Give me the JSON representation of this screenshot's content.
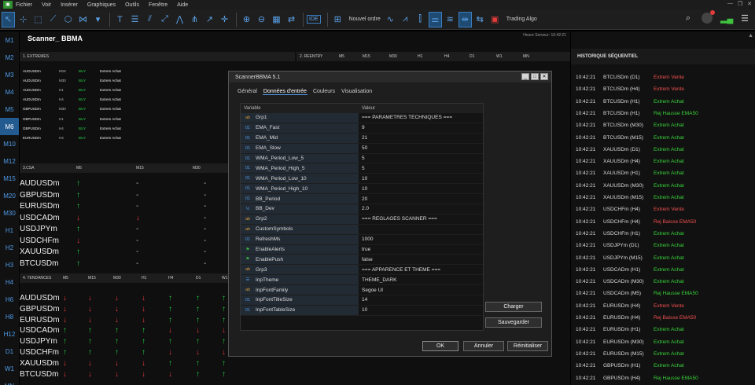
{
  "menu": {
    "items": [
      "Fichier",
      "Voir",
      "Insérer",
      "Graphiques",
      "Outils",
      "Fenêtre",
      "Aide"
    ]
  },
  "toolbar": {
    "ide": "IDE",
    "new_order": "Nouvel ordre",
    "algo": "Trading Algo"
  },
  "timeframes": [
    "M1",
    "M2",
    "M3",
    "M4",
    "M5",
    "M6",
    "M10",
    "M12",
    "M15",
    "M20",
    "M30",
    "H1",
    "H2",
    "H3",
    "H4",
    "H6",
    "H8",
    "H12",
    "D1",
    "W1",
    "MN"
  ],
  "active_timeframe": "M6",
  "panel": {
    "title": "Scanner_ BBMA",
    "info": "Heure Serveur: 10:42:21",
    "extremes": {
      "header": "1. EXTREMES",
      "rows": [
        {
          "sym": "AUDUSDm",
          "tf": "M15",
          "dir": "BUY",
          "desc": "Extrem Achat"
        },
        {
          "sym": "AUDUSDm",
          "tf": "M30",
          "dir": "BUY",
          "desc": "Extrem Achat"
        },
        {
          "sym": "AUDUSDm",
          "tf": "H1",
          "dir": "BUY",
          "desc": "Extrem Achat"
        },
        {
          "sym": "AUDUSDm",
          "tf": "H4",
          "dir": "BUY",
          "desc": "Extrem Achat"
        },
        {
          "sym": "GBPUSDm",
          "tf": "M30",
          "dir": "BUY",
          "desc": "Extrem Achat"
        },
        {
          "sym": "GBPUSDm",
          "tf": "H1",
          "dir": "BUY",
          "desc": "Extrem Achat"
        },
        {
          "sym": "GBPUSDm",
          "tf": "H4",
          "dir": "BUY",
          "desc": "Extrem Achat"
        },
        {
          "sym": "EURUSDm",
          "tf": "H4",
          "dir": "BUY",
          "desc": "Extrem Achat"
        }
      ]
    },
    "reentry": {
      "header": "2. REENTRY",
      "cols": [
        "M5",
        "M15",
        "M30",
        "H1",
        "H4",
        "D1",
        "W1",
        "MN"
      ]
    },
    "csa": {
      "header": "3.CSA",
      "cols": [
        "M5",
        "M15",
        "M30"
      ],
      "rows": [
        {
          "sym": "AUDUSDm",
          "m5": "↑",
          "m15": "-",
          "m30": "-"
        },
        {
          "sym": "GBPUSDm",
          "m5": "↑",
          "m15": "-",
          "m30": "-"
        },
        {
          "sym": "EURUSDm",
          "m5": "↑",
          "m15": "-",
          "m30": "-"
        },
        {
          "sym": "USDCADm",
          "m5": "↓",
          "m15": "↓",
          "m30": "-"
        },
        {
          "sym": "USDJPYm",
          "m5": "↑",
          "m15": "-",
          "m30": "-"
        },
        {
          "sym": "USDCHFm",
          "m5": "↓",
          "m15": "-",
          "m30": "-"
        },
        {
          "sym": "XAUUSDm",
          "m5": "↑",
          "m15": "-",
          "m30": "-"
        },
        {
          "sym": "BTCUSDm",
          "m5": "↑",
          "m15": "-",
          "m30": "-"
        }
      ]
    },
    "tendances": {
      "header": "4. TENDANCES",
      "cols": [
        "M5",
        "M15",
        "M30",
        "H1",
        "H4",
        "D1",
        "W1"
      ],
      "rows": [
        {
          "sym": "AUDUSDm",
          "v": [
            "↓",
            "↓",
            "↓",
            "↓",
            "↑",
            "↑",
            "↑"
          ]
        },
        {
          "sym": "GBPUSDm",
          "v": [
            "↓",
            "↓",
            "↓",
            "↓",
            "↑",
            "↑",
            "↑"
          ]
        },
        {
          "sym": "EURUSDm",
          "v": [
            "↓",
            "↓",
            "↓",
            "↓",
            "↑",
            "↑",
            "↑"
          ]
        },
        {
          "sym": "USDCADm",
          "v": [
            "↑",
            "↑",
            "↑",
            "↑",
            "↓",
            "↓",
            "↓"
          ]
        },
        {
          "sym": "USDJPYm",
          "v": [
            "↑",
            "↑",
            "↑",
            "↑",
            "↑",
            "↑",
            "↑"
          ]
        },
        {
          "sym": "USDCHFm",
          "v": [
            "↑",
            "↑",
            "↑",
            "↑",
            "↓",
            "↓",
            "↓"
          ]
        },
        {
          "sym": "XAUUSDm",
          "v": [
            "↓",
            "↓",
            "↓",
            "↓",
            "↑",
            "↑",
            "↑"
          ]
        },
        {
          "sym": "BTCUSDm",
          "v": [
            "↓",
            "↓",
            "↓",
            "↓",
            "↓",
            "↑",
            "↑"
          ]
        }
      ]
    }
  },
  "history": {
    "title": "HISTORIQUE SÉQUENTIEL",
    "rows": [
      {
        "time": "10:42:21",
        "sym": "BTCUSDm (D1)",
        "msg": "Extrem Vente",
        "color": "red"
      },
      {
        "time": "10:42:21",
        "sym": "BTCUSDm (H4)",
        "msg": "Extrem Vente",
        "color": "red"
      },
      {
        "time": "10:42:21",
        "sym": "BTCUSDm (H1)",
        "msg": "Extrem Achat",
        "color": "green"
      },
      {
        "time": "10:42:21",
        "sym": "BTCUSDm (H1)",
        "msg": "Rej Hausse EMA50",
        "color": "green"
      },
      {
        "time": "10:42:21",
        "sym": "BTCUSDm (M30)",
        "msg": "Extrem Achat",
        "color": "green"
      },
      {
        "time": "10:42:21",
        "sym": "BTCUSDm (M15)",
        "msg": "Extrem Achat",
        "color": "green"
      },
      {
        "time": "10:42:21",
        "sym": "XAUUSDm (D1)",
        "msg": "Extrem Achat",
        "color": "green"
      },
      {
        "time": "10:42:21",
        "sym": "XAUUSDm (H4)",
        "msg": "Extrem Achat",
        "color": "green"
      },
      {
        "time": "10:42:21",
        "sym": "XAUUSDm (H1)",
        "msg": "Extrem Achat",
        "color": "green"
      },
      {
        "time": "10:42:21",
        "sym": "XAUUSDm (M30)",
        "msg": "Extrem Achat",
        "color": "green"
      },
      {
        "time": "10:42:21",
        "sym": "XAUUSDm (M15)",
        "msg": "Extrem Achat",
        "color": "green"
      },
      {
        "time": "10:42:21",
        "sym": "USDCHFm (H4)",
        "msg": "Extrem Vente",
        "color": "red"
      },
      {
        "time": "10:42:21",
        "sym": "USDCHFm (H4)",
        "msg": "Rej Baisse EMA50",
        "color": "red"
      },
      {
        "time": "10:42:21",
        "sym": "USDCHFm (H1)",
        "msg": "Extrem Achat",
        "color": "green"
      },
      {
        "time": "10:42:21",
        "sym": "USDJPYm (D1)",
        "msg": "Extrem Achat",
        "color": "green"
      },
      {
        "time": "10:42:21",
        "sym": "USDJPYm (M15)",
        "msg": "Extrem Achat",
        "color": "green"
      },
      {
        "time": "10:42:21",
        "sym": "USDCADm (H1)",
        "msg": "Extrem Achat",
        "color": "green"
      },
      {
        "time": "10:42:21",
        "sym": "USDCADm (M30)",
        "msg": "Extrem Achat",
        "color": "green"
      },
      {
        "time": "10:42:21",
        "sym": "USDCADm (M5)",
        "msg": "Rej Hausse EMA50",
        "color": "green"
      },
      {
        "time": "10:42:21",
        "sym": "EURUSDm (H4)",
        "msg": "Extrem Vente",
        "color": "red"
      },
      {
        "time": "10:42:21",
        "sym": "EURUSDm (H4)",
        "msg": "Rej Baisse EMA50",
        "color": "red"
      },
      {
        "time": "10:42:21",
        "sym": "EURUSDm (H1)",
        "msg": "Extrem Achat",
        "color": "green"
      },
      {
        "time": "10:42:21",
        "sym": "EURUSDm (M30)",
        "msg": "Extrem Achat",
        "color": "green"
      },
      {
        "time": "10:42:21",
        "sym": "EURUSDm (M15)",
        "msg": "Extrem Achat",
        "color": "green"
      },
      {
        "time": "10:42:21",
        "sym": "GBPUSDm (H1)",
        "msg": "Extrem Achat",
        "color": "green"
      },
      {
        "time": "10:42:21",
        "sym": "GBPUSDm (H4)",
        "msg": "Rej Hausse EMA50",
        "color": "green"
      }
    ]
  },
  "dialog": {
    "title": "ScannerBBMA 5.1",
    "tabs": [
      "Général",
      "Données d'entrée",
      "Couleurs",
      "Visualisation"
    ],
    "active_tab": "Données d'entrée",
    "col_variable": "Variable",
    "col_value": "Valeur",
    "params": [
      {
        "icon": "ab",
        "name": "Grp1",
        "value": "=== PARAMETRES TECHNIQUES ==="
      },
      {
        "icon": "01",
        "name": "EMA_Fast",
        "value": "9"
      },
      {
        "icon": "01",
        "name": "EMA_Mid",
        "value": "21"
      },
      {
        "icon": "01",
        "name": "EMA_Slow",
        "value": "50"
      },
      {
        "icon": "01",
        "name": "WMA_Period_Low_5",
        "value": "5"
      },
      {
        "icon": "01",
        "name": "WMA_Period_High_5",
        "value": "5"
      },
      {
        "icon": "01",
        "name": "WMA_Period_Low_10",
        "value": "10"
      },
      {
        "icon": "01",
        "name": "WMA_Period_High_10",
        "value": "10"
      },
      {
        "icon": "01",
        "name": "BB_Period",
        "value": "20"
      },
      {
        "icon": "½",
        "name": "BB_Dev",
        "value": "2.0"
      },
      {
        "icon": "ab",
        "name": "Grp2",
        "value": "=== REGLAGES SCANNER ==="
      },
      {
        "icon": "ab",
        "name": "CustomSymbols",
        "value": ""
      },
      {
        "icon": "01",
        "name": "RefreshMs",
        "value": "1000"
      },
      {
        "icon": "flag",
        "name": "EnableAlerts",
        "value": "true"
      },
      {
        "icon": "flag",
        "name": "EnablePush",
        "value": "false"
      },
      {
        "icon": "ab",
        "name": "Grp3",
        "value": "=== APPARENCE ET THEME ==="
      },
      {
        "icon": "list",
        "name": "InpTheme",
        "value": "THEME_DARK"
      },
      {
        "icon": "ab",
        "name": "InpFontFamily",
        "value": "Segoe UI"
      },
      {
        "icon": "01",
        "name": "InpFontTitleSize",
        "value": "14"
      },
      {
        "icon": "01",
        "name": "InpFontTableSize",
        "value": "10"
      }
    ],
    "btn_load": "Charger",
    "btn_save": "Sauvegarder",
    "btn_ok": "OK",
    "btn_cancel": "Annuler",
    "btn_reset": "Réinitialiser"
  }
}
